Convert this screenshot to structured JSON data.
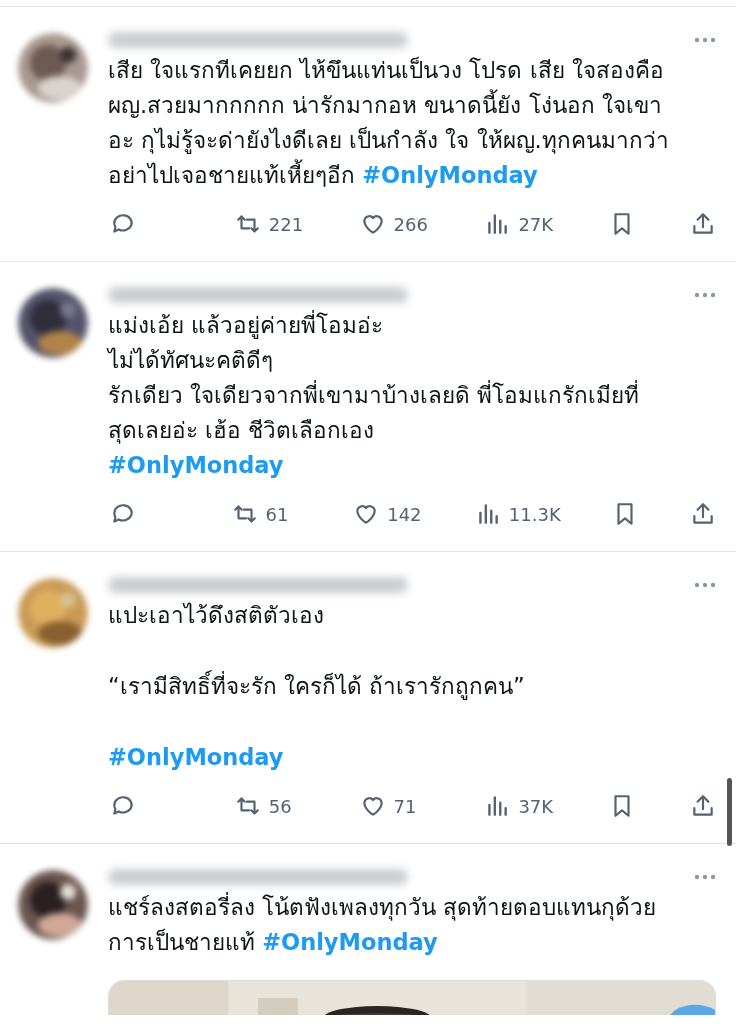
{
  "tweets": [
    {
      "paragraphs": [
        [
          {
            "text": "เสีย ใจแรกทีเคยยก ไห้ขึนแท่นเป็นวง โปรด เสีย ใจสองคือ"
          },
          {
            "text": "ผญ.สวยมากกกกก น่ารักมากอห ขนาดนี้ยัง โง่นอก ใจเขา"
          },
          {
            "text": "อะ กุไม่รู้จะด่ายังไงดีเลย เป็นกำลัง ใจ ให้ผญ.ทุกคนมากว่า"
          },
          {
            "text": "อย่าไปเจอชายแท้เหี้ยๆอีก ",
            "hashtag": "#OnlyMonday"
          }
        ]
      ],
      "actions": {
        "retweets": "221",
        "likes": "266",
        "views": "27K"
      }
    },
    {
      "paragraphs": [
        [
          {
            "text": "แม่งเอ้ย แล้วอยู่ค่ายพี่โอมอ่ะ"
          },
          {
            "text": "ไม่ได้ทัศนะคติดีๆ"
          },
          {
            "text": "รักเดียว ใจเดียวจากพี่เขามาบ้างเลยดิ  พี่โอมแกรักเมียที่"
          },
          {
            "text": "สุดเลยอ่ะ เฮ้อ ชีวิตเลือกเอง"
          },
          {
            "hashtag": "#OnlyMonday"
          }
        ]
      ],
      "actions": {
        "retweets": "61",
        "likes": "142",
        "views": "11.3K"
      }
    },
    {
      "paragraphs": [
        [
          {
            "text": "แปะเอาไว้ดึงสติตัวเอง"
          }
        ],
        [
          {
            "text": "“เรามีสิทธิ์ที่จะรัก ใครก็ได้ ถ้าเรารักถูกคน”"
          }
        ],
        [
          {
            "hashtag": "#OnlyMonday"
          }
        ]
      ],
      "actions": {
        "retweets": "56",
        "likes": "71",
        "views": "37K"
      }
    },
    {
      "paragraphs": [
        [
          {
            "text": "แชร์ลงสตอรี่ลง โน้ตฟังเพลงทุกวัน สุดท้ายตอบแทนกุด้วย"
          },
          {
            "text": "การเป็นชายแท้ ",
            "hashtag": "#OnlyMonday"
          }
        ]
      ],
      "media": {
        "kind": "picture"
      }
    }
  ]
}
